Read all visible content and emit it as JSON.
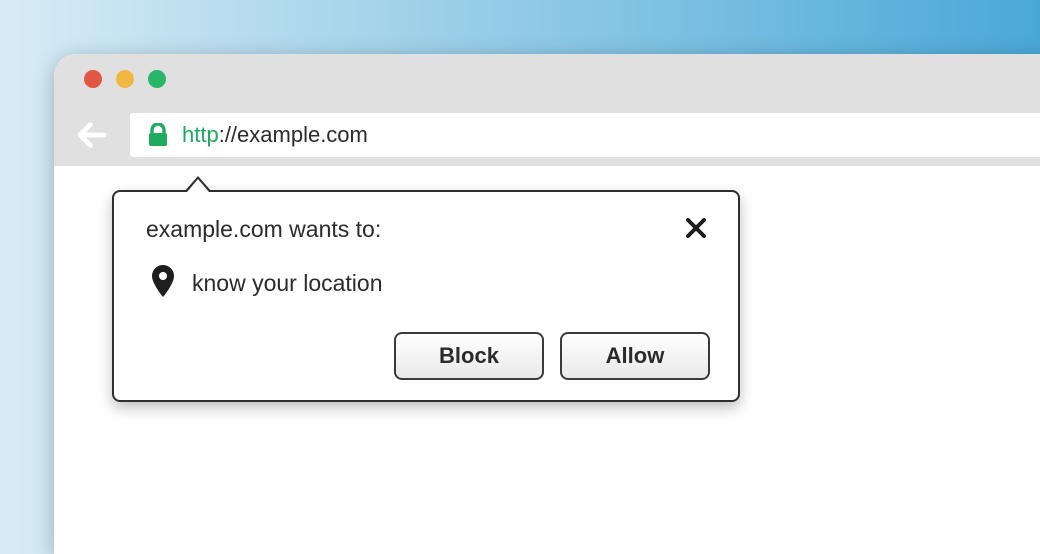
{
  "address_bar": {
    "protocol_text": "http",
    "rest_text": "://example.com"
  },
  "permission_prompt": {
    "title": "example.com wants to:",
    "request_text": "know your location",
    "block_label": "Block",
    "allow_label": "Allow"
  }
}
